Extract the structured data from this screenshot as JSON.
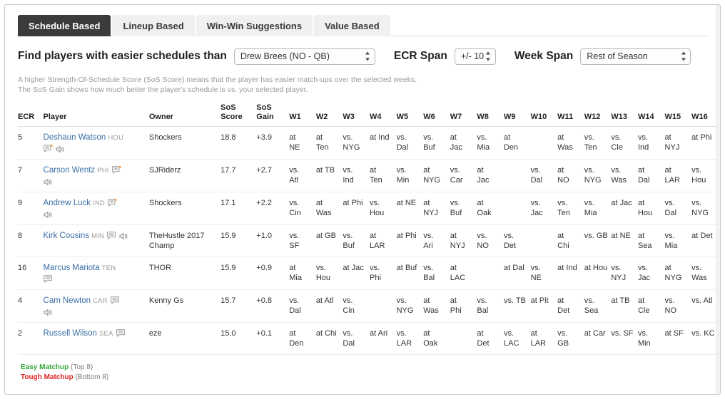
{
  "tabs": [
    {
      "label": "Schedule Based",
      "active": true
    },
    {
      "label": "Lineup Based",
      "active": false
    },
    {
      "label": "Win-Win Suggestions",
      "active": false
    },
    {
      "label": "Value Based",
      "active": false
    }
  ],
  "filters": {
    "find_label": "Find players with easier schedules than",
    "player_select": "Drew Brees (NO - QB)",
    "ecr_label": "ECR Span",
    "ecr_select": "+/- 10",
    "week_label": "Week Span",
    "week_select": "Rest of Season"
  },
  "help": {
    "line1": "A higher Strength-Of-Schedule Score (SoS Score) means that the player has easier match-ups over the selected weeks.",
    "line2": "The SoS Gain shows how much better the player's schedule is vs. your selected player."
  },
  "table": {
    "headers": {
      "ecr": "ECR",
      "player": "Player",
      "owner": "Owner",
      "sos_score_l1": "SoS",
      "sos_score_l2": "Score",
      "sos_gain_l1": "SoS",
      "sos_gain_l2": "Gain",
      "weeks": [
        "W1",
        "W2",
        "W3",
        "W4",
        "W5",
        "W6",
        "W7",
        "W8",
        "W9",
        "W10",
        "W11",
        "W12",
        "W13",
        "W14",
        "W15",
        "W16"
      ]
    },
    "rows": [
      {
        "ecr": "5",
        "name": "Deshaun Watson",
        "team": "HOU",
        "owner": "Shockers",
        "sos_score": "18.8",
        "sos_gain": "+3.9",
        "icons_after_name": [],
        "icons_below": [
          "note-new-icon",
          "speaker-icon"
        ],
        "weeks": [
          {
            "l1": "at",
            "l2": "NE",
            "color": "green"
          },
          {
            "l1": "at",
            "l2": "Ten",
            "color": "dark"
          },
          {
            "l1": "vs.",
            "l2": "NYG",
            "color": "green"
          },
          {
            "l1": "at Ind",
            "l2": "",
            "color": "green"
          },
          {
            "l1": "vs.",
            "l2": "Dal",
            "color": "dark"
          },
          {
            "l1": "vs.",
            "l2": "Buf",
            "color": "red"
          },
          {
            "l1": "at",
            "l2": "Jac",
            "color": "red"
          },
          {
            "l1": "vs.",
            "l2": "Mia",
            "color": "dark"
          },
          {
            "l1": "at",
            "l2": "Den",
            "color": "dark"
          },
          {
            "l1": "",
            "l2": "",
            "color": "dark"
          },
          {
            "l1": "at",
            "l2": "Was",
            "color": "dark"
          },
          {
            "l1": "vs.",
            "l2": "Ten",
            "color": "dark"
          },
          {
            "l1": "vs.",
            "l2": "Cle",
            "color": "green"
          },
          {
            "l1": "vs.",
            "l2": "Ind",
            "color": "green"
          },
          {
            "l1": "at",
            "l2": "NYJ",
            "color": "green"
          },
          {
            "l1": "at Phi",
            "l2": "",
            "color": "dark"
          }
        ]
      },
      {
        "ecr": "7",
        "name": "Carson Wentz",
        "team": "PHI",
        "owner": "SJRiderz",
        "sos_score": "17.7",
        "sos_gain": "+2.7",
        "icons_after_name": [
          "note-new-icon"
        ],
        "icons_below": [
          "speaker-icon"
        ],
        "weeks": [
          {
            "l1": "vs.",
            "l2": "Atl",
            "color": "dark"
          },
          {
            "l1": "at TB",
            "l2": "",
            "color": "dark"
          },
          {
            "l1": "vs.",
            "l2": "Ind",
            "color": "green"
          },
          {
            "l1": "at",
            "l2": "Ten",
            "color": "dark"
          },
          {
            "l1": "vs.",
            "l2": "Min",
            "color": "red"
          },
          {
            "l1": "at",
            "l2": "NYG",
            "color": "green"
          },
          {
            "l1": "vs.",
            "l2": "Car",
            "color": "dark"
          },
          {
            "l1": "at",
            "l2": "Jac",
            "color": "red"
          },
          {
            "l1": "",
            "l2": "",
            "color": "dark"
          },
          {
            "l1": "vs.",
            "l2": "Dal",
            "color": "dark"
          },
          {
            "l1": "at",
            "l2": "NO",
            "color": "dark"
          },
          {
            "l1": "vs.",
            "l2": "NYG",
            "color": "green"
          },
          {
            "l1": "vs.",
            "l2": "Was",
            "color": "dark"
          },
          {
            "l1": "at",
            "l2": "Dal",
            "color": "dark"
          },
          {
            "l1": "at",
            "l2": "LAR",
            "color": "dark"
          },
          {
            "l1": "vs.",
            "l2": "Hou",
            "color": "green"
          }
        ]
      },
      {
        "ecr": "9",
        "name": "Andrew Luck",
        "team": "IND",
        "owner": "Shockers",
        "sos_score": "17.1",
        "sos_gain": "+2.2",
        "icons_after_name": [
          "note-new-icon"
        ],
        "icons_below": [
          "speaker-icon"
        ],
        "weeks": [
          {
            "l1": "vs.",
            "l2": "Cin",
            "color": "dark"
          },
          {
            "l1": "at",
            "l2": "Was",
            "color": "dark"
          },
          {
            "l1": "at Phi",
            "l2": "",
            "color": "dark"
          },
          {
            "l1": "vs.",
            "l2": "Hou",
            "color": "green"
          },
          {
            "l1": "at NE",
            "l2": "",
            "color": "green"
          },
          {
            "l1": "at",
            "l2": "NYJ",
            "color": "green"
          },
          {
            "l1": "vs.",
            "l2": "Buf",
            "color": "red"
          },
          {
            "l1": "at",
            "l2": "Oak",
            "color": "dark"
          },
          {
            "l1": "",
            "l2": "",
            "color": "dark"
          },
          {
            "l1": "vs.",
            "l2": "Jac",
            "color": "red"
          },
          {
            "l1": "vs.",
            "l2": "Ten",
            "color": "dark"
          },
          {
            "l1": "vs.",
            "l2": "Mia",
            "color": "dark"
          },
          {
            "l1": "at Jac",
            "l2": "",
            "color": "red"
          },
          {
            "l1": "at",
            "l2": "Hou",
            "color": "green"
          },
          {
            "l1": "vs.",
            "l2": "Dal",
            "color": "dark"
          },
          {
            "l1": "vs.",
            "l2": "NYG",
            "color": "green"
          }
        ]
      },
      {
        "ecr": "8",
        "name": "Kirk Cousins",
        "team": "MIN",
        "owner": "TheHustle 2017 Champ",
        "sos_score": "15.9",
        "sos_gain": "+1.0",
        "icons_after_name": [
          "note-icon",
          "speaker-icon"
        ],
        "icons_below": [],
        "weeks": [
          {
            "l1": "vs.",
            "l2": "SF",
            "color": "green"
          },
          {
            "l1": "at GB",
            "l2": "",
            "color": "green"
          },
          {
            "l1": "vs.",
            "l2": "Buf",
            "color": "red"
          },
          {
            "l1": "at",
            "l2": "LAR",
            "color": "dark"
          },
          {
            "l1": "at Phi",
            "l2": "",
            "color": "dark"
          },
          {
            "l1": "vs.",
            "l2": "Ari",
            "color": "dark"
          },
          {
            "l1": "at",
            "l2": "NYJ",
            "color": "green"
          },
          {
            "l1": "vs.",
            "l2": "NO",
            "color": "dark"
          },
          {
            "l1": "vs.",
            "l2": "Det",
            "color": "dark"
          },
          {
            "l1": "",
            "l2": "",
            "color": "dark"
          },
          {
            "l1": "at",
            "l2": "Chi",
            "color": "red"
          },
          {
            "l1": "vs. GB",
            "l2": "",
            "color": "green"
          },
          {
            "l1": "at NE",
            "l2": "",
            "color": "green"
          },
          {
            "l1": "at",
            "l2": "Sea",
            "color": "red"
          },
          {
            "l1": "vs.",
            "l2": "Mia",
            "color": "dark"
          },
          {
            "l1": "at Det",
            "l2": "",
            "color": "dark"
          }
        ]
      },
      {
        "ecr": "16",
        "name": "Marcus Mariota",
        "team": "TEN",
        "owner": "THOR",
        "sos_score": "15.9",
        "sos_gain": "+0.9",
        "icons_after_name": [],
        "icons_below": [
          "note-icon"
        ],
        "weeks": [
          {
            "l1": "at",
            "l2": "Mia",
            "color": "dark"
          },
          {
            "l1": "vs.",
            "l2": "Hou",
            "color": "green"
          },
          {
            "l1": "at Jac",
            "l2": "",
            "color": "red"
          },
          {
            "l1": "vs.",
            "l2": "Phi",
            "color": "dark"
          },
          {
            "l1": "at Buf",
            "l2": "",
            "color": "red"
          },
          {
            "l1": "vs.",
            "l2": "Bal",
            "color": "red"
          },
          {
            "l1": "at",
            "l2": "LAC",
            "color": "red"
          },
          {
            "l1": "",
            "l2": "",
            "color": "dark"
          },
          {
            "l1": "at Dal",
            "l2": "",
            "color": "dark"
          },
          {
            "l1": "vs.",
            "l2": "NE",
            "color": "green"
          },
          {
            "l1": "at Ind",
            "l2": "",
            "color": "green"
          },
          {
            "l1": "at Hou",
            "l2": "",
            "color": "green"
          },
          {
            "l1": "vs.",
            "l2": "NYJ",
            "color": "green"
          },
          {
            "l1": "vs.",
            "l2": "Jac",
            "color": "red"
          },
          {
            "l1": "at",
            "l2": "NYG",
            "color": "green"
          },
          {
            "l1": "vs.",
            "l2": "Was",
            "color": "dark"
          }
        ]
      },
      {
        "ecr": "4",
        "name": "Cam Newton",
        "team": "CAR",
        "owner": "Kenny Gs",
        "sos_score": "15.7",
        "sos_gain": "+0.8",
        "icons_after_name": [
          "note-icon"
        ],
        "icons_below": [
          "speaker-icon"
        ],
        "weeks": [
          {
            "l1": "vs.",
            "l2": "Dal",
            "color": "dark"
          },
          {
            "l1": "at Atl",
            "l2": "",
            "color": "dark"
          },
          {
            "l1": "vs.",
            "l2": "Cin",
            "color": "dark"
          },
          {
            "l1": "",
            "l2": "",
            "color": "dark"
          },
          {
            "l1": "vs.",
            "l2": "NYG",
            "color": "green"
          },
          {
            "l1": "at",
            "l2": "Was",
            "color": "dark"
          },
          {
            "l1": "at",
            "l2": "Phi",
            "color": "dark"
          },
          {
            "l1": "vs.",
            "l2": "Bal",
            "color": "red"
          },
          {
            "l1": "vs. TB",
            "l2": "",
            "color": "dark"
          },
          {
            "l1": "at Pit",
            "l2": "",
            "color": "red"
          },
          {
            "l1": "at",
            "l2": "Det",
            "color": "dark"
          },
          {
            "l1": "vs.",
            "l2": "Sea",
            "color": "red"
          },
          {
            "l1": "at TB",
            "l2": "",
            "color": "dark"
          },
          {
            "l1": "at",
            "l2": "Cle",
            "color": "green"
          },
          {
            "l1": "vs.",
            "l2": "NO",
            "color": "dark"
          },
          {
            "l1": "vs. Atl",
            "l2": "",
            "color": "dark"
          }
        ]
      },
      {
        "ecr": "2",
        "name": "Russell Wilson",
        "team": "SEA",
        "owner": "eze",
        "sos_score": "15.0",
        "sos_gain": "+0.1",
        "icons_after_name": [
          "note-icon"
        ],
        "icons_below": [],
        "weeks": [
          {
            "l1": "at",
            "l2": "Den",
            "color": "dark"
          },
          {
            "l1": "at Chi",
            "l2": "",
            "color": "red"
          },
          {
            "l1": "vs.",
            "l2": "Dal",
            "color": "dark"
          },
          {
            "l1": "at Ari",
            "l2": "",
            "color": "dark"
          },
          {
            "l1": "vs.",
            "l2": "LAR",
            "color": "dark"
          },
          {
            "l1": "at",
            "l2": "Oak",
            "color": "dark"
          },
          {
            "l1": "",
            "l2": "",
            "color": "dark"
          },
          {
            "l1": "at",
            "l2": "Det",
            "color": "dark"
          },
          {
            "l1": "vs.",
            "l2": "LAC",
            "color": "red"
          },
          {
            "l1": "at",
            "l2": "LAR",
            "color": "dark"
          },
          {
            "l1": "vs.",
            "l2": "GB",
            "color": "green"
          },
          {
            "l1": "at Car",
            "l2": "",
            "color": "dark"
          },
          {
            "l1": "vs. SF",
            "l2": "",
            "color": "green"
          },
          {
            "l1": "vs.",
            "l2": "Min",
            "color": "red"
          },
          {
            "l1": "at SF",
            "l2": "",
            "color": "green"
          },
          {
            "l1": "vs. KC",
            "l2": "",
            "color": "dark"
          }
        ]
      }
    ]
  },
  "legend": {
    "easy_label": "Easy Matchup",
    "easy_note": "(Top 8)",
    "tough_label": "Tough Matchup",
    "tough_note": "(Bottom 8)"
  },
  "colors": {
    "easy": "#34a83a",
    "tough": "#e02020",
    "link": "#3a6ea5",
    "tab_active_bg": "#3b3b3b"
  }
}
